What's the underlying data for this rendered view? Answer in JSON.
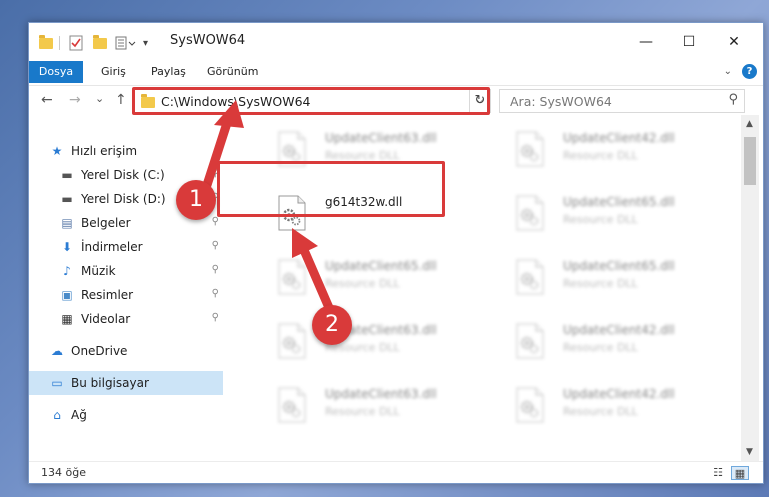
{
  "window": {
    "title": "SysWOW64",
    "minimize": "—",
    "maximize": "☐",
    "close": "✕"
  },
  "ribbon": {
    "tabs": [
      "Dosya",
      "Giriş",
      "Paylaş",
      "Görünüm"
    ],
    "expand_icon": "chevron-down-icon",
    "help": "?"
  },
  "address": {
    "path": "C:\\Windows\\SysWOW64",
    "dropdown": "⌵",
    "refresh": "↻",
    "search_placeholder": "Ara: SysWOW64",
    "search_icon": "⚲"
  },
  "nav": {
    "back": "←",
    "forward": "→",
    "recent": "⌄",
    "up": "↑"
  },
  "sidebar": {
    "items": [
      {
        "label": "Hızlı erişim",
        "icon": "star-icon",
        "glyph": "★",
        "color": "#2b7cd3",
        "pinned": false
      },
      {
        "label": "Yerel Disk (C:)",
        "icon": "drive-icon",
        "glyph": "▬",
        "color": "#555555",
        "pinned": true
      },
      {
        "label": "Yerel Disk (D:)",
        "icon": "drive-icon",
        "glyph": "▬",
        "color": "#555555",
        "pinned": true
      },
      {
        "label": "Belgeler",
        "icon": "documents-icon",
        "glyph": "▤",
        "color": "#5a7aa8",
        "pinned": true
      },
      {
        "label": "İndirmeler",
        "icon": "download-icon",
        "glyph": "⬇",
        "color": "#2b7cd3",
        "pinned": true
      },
      {
        "label": "Müzik",
        "icon": "music-icon",
        "glyph": "♪",
        "color": "#2b7cd3",
        "pinned": true
      },
      {
        "label": "Resimler",
        "icon": "pictures-icon",
        "glyph": "▣",
        "color": "#4a8bc9",
        "pinned": true
      },
      {
        "label": "Videolar",
        "icon": "videos-icon",
        "glyph": "▦",
        "color": "#333333",
        "pinned": true
      },
      {
        "label": "OneDrive",
        "icon": "cloud-icon",
        "glyph": "☁",
        "color": "#2b7cd3",
        "pinned": false
      },
      {
        "label": "Bu bilgisayar",
        "icon": "computer-icon",
        "glyph": "▭",
        "color": "#2b7cd3",
        "pinned": false,
        "selected": true
      },
      {
        "label": "Ağ",
        "icon": "network-icon",
        "glyph": "⌂",
        "color": "#2b7cd3",
        "pinned": false
      }
    ],
    "pin_glyph": "📌"
  },
  "files": [
    {
      "name": "UpdateClient63.dll",
      "type": "Resource DLL",
      "blurred": true
    },
    {
      "name": "UpdateClient42.dll",
      "type": "Resource DLL",
      "blurred": true
    },
    {
      "name": "g614t32w.dll",
      "type": "",
      "blurred": false
    },
    {
      "name": "UpdateClient65.dll",
      "type": "Resource DLL",
      "blurred": true
    },
    {
      "name": "UpdateClient65.dll",
      "type": "Resource DLL",
      "blurred": true
    },
    {
      "name": "UpdateClient65.dll",
      "type": "Resource DLL",
      "blurred": true
    },
    {
      "name": "UpdateClient63.dll",
      "type": "Resource DLL",
      "blurred": true
    },
    {
      "name": "UpdateClient42.dll",
      "type": "Resource DLL",
      "blurred": true
    },
    {
      "name": "UpdateClient63.dll",
      "type": "Resource DLL",
      "blurred": true
    },
    {
      "name": "UpdateClient42.dll",
      "type": "Resource DLL",
      "blurred": true
    }
  ],
  "status": {
    "count": "134 öğe"
  },
  "annotations": {
    "step1": "1",
    "step2": "2",
    "color": "#d93a3a"
  }
}
